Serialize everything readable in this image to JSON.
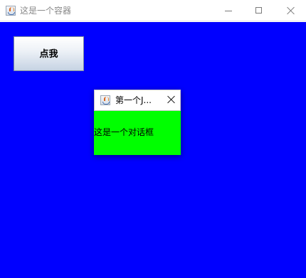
{
  "main_window": {
    "title": "这是一个容器",
    "title_icon": "java-icon",
    "controls": {
      "minimize_icon": "minimize-icon",
      "maximize_icon": "maximize-icon",
      "close_icon": "close-icon"
    },
    "background_color": "#0000ff",
    "button_label": "点我"
  },
  "dialog": {
    "title": "第一个J...",
    "title_icon": "java-icon",
    "close_icon": "close-icon",
    "body_text": "这是一个对话框",
    "background_color": "#00ff00"
  }
}
